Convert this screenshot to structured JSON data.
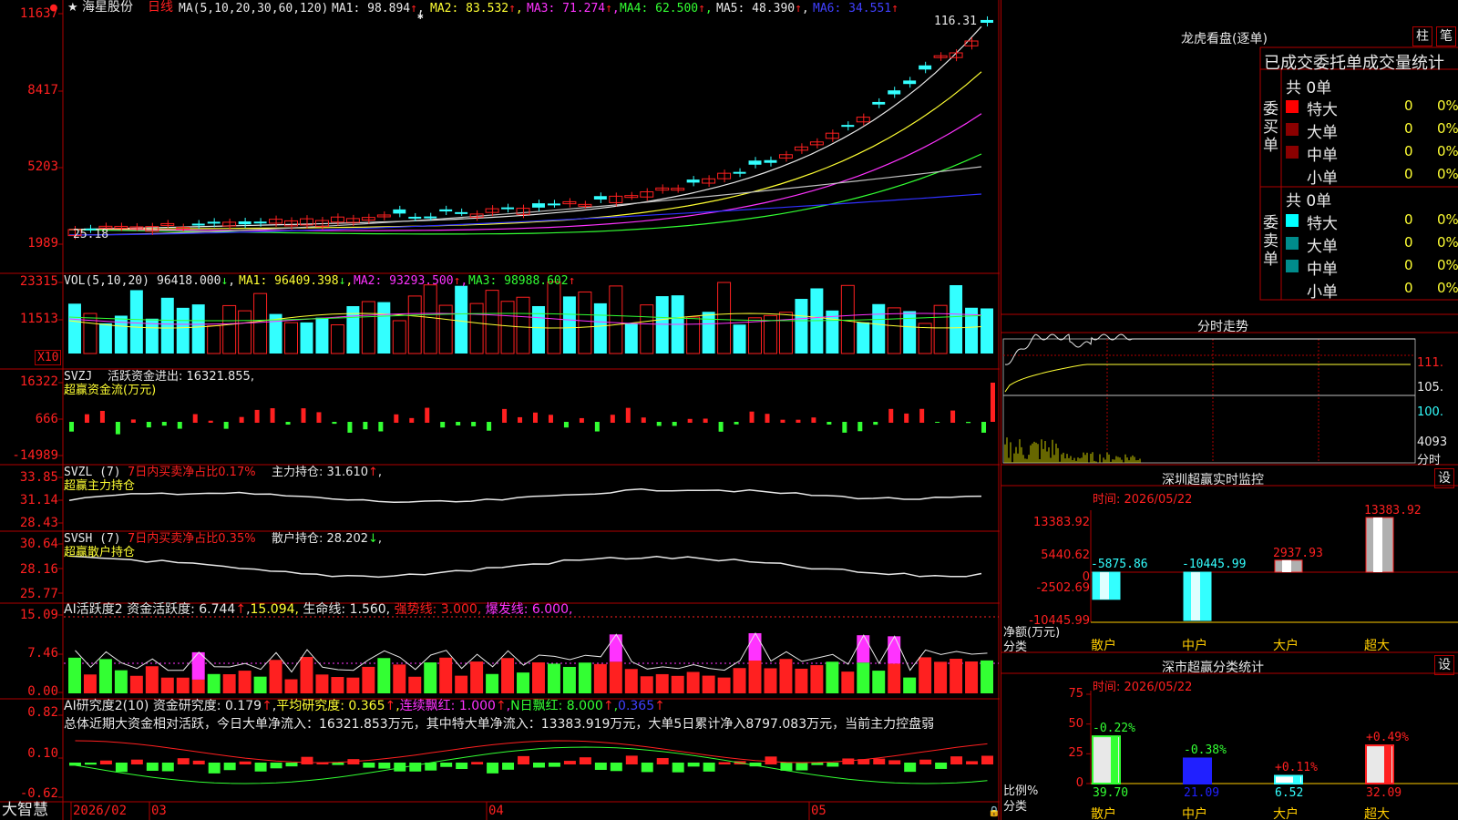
{
  "app": {
    "brand": "大智慧"
  },
  "stock": {
    "name": "海星股份",
    "period": "日线"
  },
  "main_panel": {
    "ma_def": "MA(5,10,20,30,60,120)",
    "ma1": "MA1: 98.894",
    "ma2": "MA2: 83.532",
    "ma3": "MA3: 71.274",
    "ma4": "MA4: 62.500",
    "ma5": "MA5: 48.390",
    "ma6": "MA6: 34.551",
    "up": "↑",
    "comma": ",",
    "y_ticks": [
      "11637",
      "8417",
      "5203",
      "1989"
    ],
    "high_label": "116.31",
    "low_label": "25.18"
  },
  "vol_panel": {
    "def": "VOL(5,10,20)",
    "val": "96418.000",
    "arrow_dn": "↓",
    "ma1": "MA1: 96409.398",
    "ma2": "MA2: 93293.500",
    "ma3": "MA3: 98988.602",
    "y_ticks": [
      "23315",
      "11513"
    ],
    "unit": "X10"
  },
  "svzj": {
    "title": "SVZJ",
    "line": "活跃资金进出: 16321.855",
    "sub": "超赢资金流(万元)",
    "y_ticks": [
      "16322",
      "666",
      "-14989"
    ]
  },
  "svzl": {
    "title": "SVZL  (7)",
    "share": "7日内买卖净占比0.17%",
    "hold": "主力持仓: 31.610",
    "sub": "超赢主力持仓",
    "y_ticks": [
      "33.85",
      "31.14",
      "28.43"
    ]
  },
  "svsh": {
    "title": "SVSH  (7)",
    "share": "7日内买卖净占比0.35%",
    "hold": "散户持仓: 28.202",
    "sub": "超赢散户持仓",
    "y_ticks": [
      "30.64",
      "28.16",
      "25.77"
    ]
  },
  "ai_active": {
    "title": "AI活跃度2",
    "a": "资金活跃度: 6.744",
    "b": "15.094",
    "c": "生命线: 1.560",
    "d": "强势线: 3.000",
    "e": "爆发线: 6.000",
    "y_ticks": [
      "15.09",
      "7.46",
      "0.00"
    ]
  },
  "ai_research": {
    "title": "AI研究度2(10)",
    "a": "资金研究度: 0.179",
    "b": "平均研究度: 0.365",
    "c": "连续飘红: 1.000",
    "d": "N日飘红: 8.000",
    "e": "0.365",
    "summary": "总体近期大资金相对活跃，今日大单净流入：16321.853万元，其中特大单净流入：13383.919万元，大单5日累计净入8797.083万元，当前主力控盘弱",
    "y_ticks": [
      "0.82",
      "0.10",
      "-0.62"
    ]
  },
  "dates": [
    "2026/02",
    "03",
    "04",
    "05"
  ],
  "lhb": {
    "title": "龙虎看盘(逐单)",
    "btn1": "柱",
    "btn2": "笔",
    "header": "已成交委托单成交量统计",
    "buy_label": "委买单",
    "sell_label": "委卖单",
    "buy_total": "共 0单",
    "sell_total": "共 0单",
    "buy_rows": [
      {
        "name": "特大",
        "num": "0",
        "pct": "0%"
      },
      {
        "name": "大单",
        "num": "0",
        "pct": "0%"
      },
      {
        "name": "中单",
        "num": "0",
        "pct": "0%"
      },
      {
        "name": "小单",
        "num": "0",
        "pct": "0%"
      }
    ],
    "sell_rows": [
      {
        "name": "特大",
        "num": "0",
        "pct": "0%"
      },
      {
        "name": "大单",
        "num": "0",
        "pct": "0%"
      },
      {
        "name": "中单",
        "num": "0",
        "pct": "0%"
      },
      {
        "name": "小单",
        "num": "0",
        "pct": "0%"
      }
    ],
    "colors": {
      "buy1": "#ff0000",
      "buy2": "#8b0000",
      "buy3": "#8b0000",
      "sell1": "#00ffff",
      "sell2": "#008b8b",
      "sell3": "#008b8b"
    }
  },
  "fenshi": {
    "title": "分时走势",
    "y_ticks": [
      "111.",
      "105.",
      "100."
    ],
    "vol_tick": "4093",
    "vol_label": "分时"
  },
  "sz_monitor": {
    "title": "深圳超赢实时监控",
    "btn": "设",
    "time": "时间: 2026/05/22",
    "y_ticks": [
      "13383.92",
      "5440.62",
      "0",
      "-2502.69",
      "-10445.99"
    ],
    "axis_title": "净额(万元)",
    "axis_sub": "分类",
    "categories": [
      "散户",
      "中户",
      "大户",
      "超大"
    ],
    "values": [
      -5875.86,
      -10445.99,
      2937.93,
      13383.92
    ],
    "labels": [
      "-5875.86",
      "-10445.99",
      "2937.93",
      "13383.92"
    ]
  },
  "sh_stats": {
    "title": "深市超赢分类统计",
    "btn": "设",
    "time": "时间: 2026/05/22",
    "y_ticks": [
      "75",
      "50",
      "25",
      "0"
    ],
    "axis_title": "比例%",
    "axis_sub": "分类",
    "categories": [
      "散户",
      "中户",
      "大户",
      "超大"
    ],
    "values": [
      39.7,
      21.09,
      6.52,
      32.09
    ],
    "values_text": [
      "39.70",
      "21.09",
      "6.52",
      "32.09"
    ],
    "changes": [
      "-0.22%",
      "-0.38%",
      "+0.11%",
      "+0.49%"
    ]
  }
}
